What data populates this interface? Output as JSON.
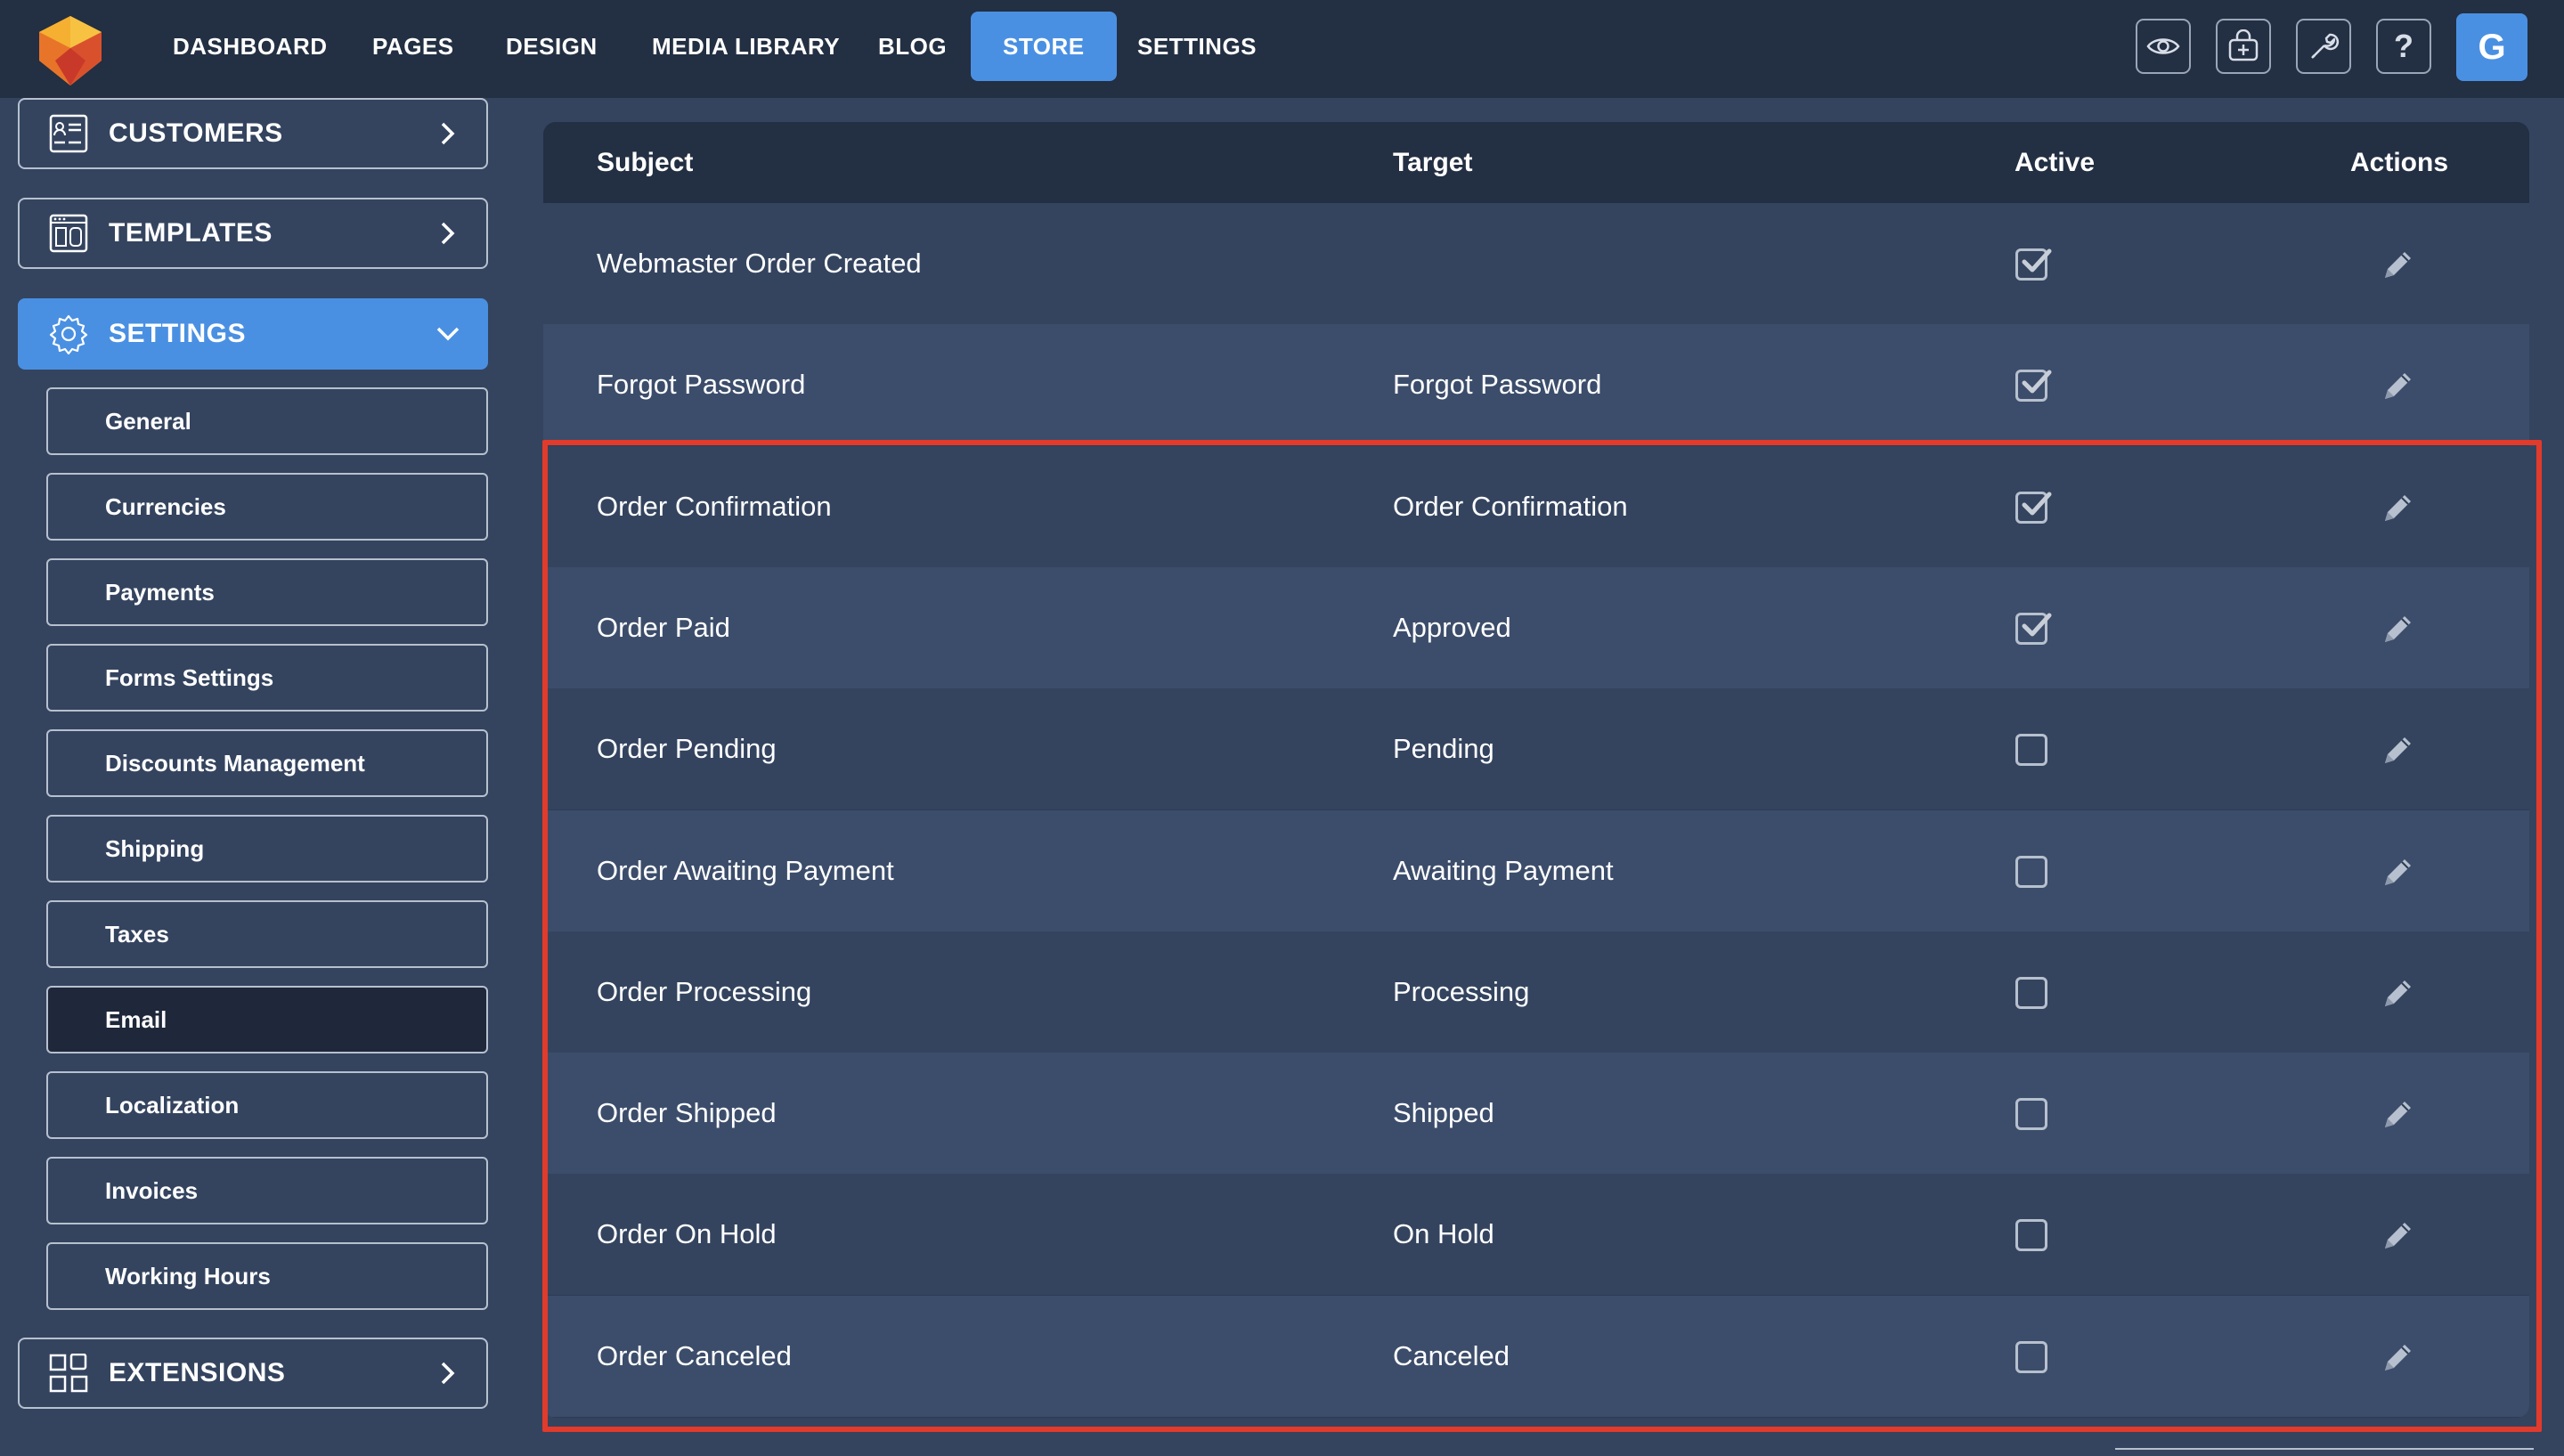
{
  "nav": {
    "items": [
      "DASHBOARD",
      "PAGES",
      "DESIGN",
      "MEDIA LIBRARY",
      "BLOG",
      "STORE",
      "SETTINGS"
    ],
    "active": "STORE",
    "user_initial": "G"
  },
  "sidebar": {
    "customers": "CUSTOMERS",
    "templates": "TEMPLATES",
    "settings": "SETTINGS",
    "extensions": "EXTENSIONS",
    "sub_items": [
      "General",
      "Currencies",
      "Payments",
      "Forms Settings",
      "Discounts Management",
      "Shipping",
      "Taxes",
      "Email",
      "Localization",
      "Invoices",
      "Working Hours"
    ],
    "active_sub": "Email"
  },
  "table": {
    "headers": {
      "subject": "Subject",
      "target": "Target",
      "active": "Active",
      "actions": "Actions"
    },
    "rows": [
      {
        "subject": "Webmaster Order Created",
        "target": "",
        "active": true
      },
      {
        "subject": "Forgot Password",
        "target": "Forgot Password",
        "active": true
      },
      {
        "subject": "Order Confirmation",
        "target": "Order Confirmation",
        "active": true
      },
      {
        "subject": "Order Paid",
        "target": "Approved",
        "active": true
      },
      {
        "subject": "Order Pending",
        "target": "Pending",
        "active": false
      },
      {
        "subject": "Order Awaiting Payment",
        "target": "Awaiting Payment",
        "active": false
      },
      {
        "subject": "Order Processing",
        "target": "Processing",
        "active": false
      },
      {
        "subject": "Order Shipped",
        "target": "Shipped",
        "active": false
      },
      {
        "subject": "Order On Hold",
        "target": "On Hold",
        "active": false
      },
      {
        "subject": "Order Canceled",
        "target": "Canceled",
        "active": false
      }
    ]
  },
  "colors": {
    "accent": "#4a90e2",
    "highlight": "#e23a2b",
    "topbar": "#232f42",
    "background": "#34445f"
  }
}
